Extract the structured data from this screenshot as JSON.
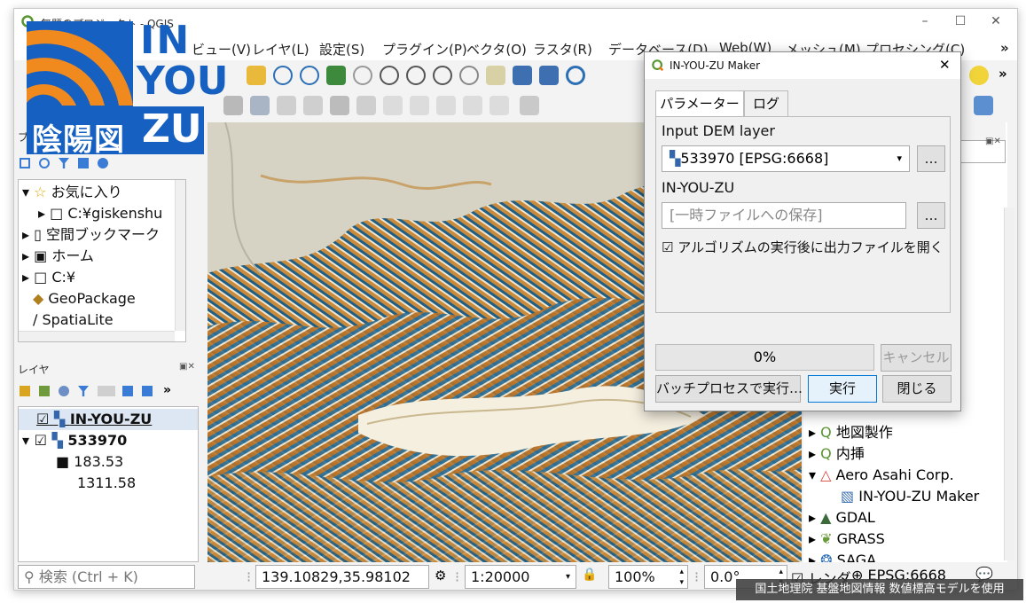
{
  "window": {
    "title": "無題のプロジェクト - QGIS"
  },
  "menubar": {
    "items": [
      "ビュー(V)",
      "レイヤ(L)",
      "設定(S)",
      "プラグイン(P)",
      "ベクタ(O)",
      "ラスタ(R)",
      "データベース(D)",
      "Web(W)",
      "メッシュ(M)",
      "プロセシング(C)"
    ],
    "more": "»"
  },
  "logo": {
    "line1": "IN",
    "line2": "YOU",
    "line3": "ZU",
    "kanji": "陰陽図"
  },
  "browser_panel": {
    "title": "ブ",
    "items": [
      {
        "label": "お気に入り"
      },
      {
        "label": "C:¥giskenshu"
      },
      {
        "label": "空間ブックマーク"
      },
      {
        "label": "ホーム"
      },
      {
        "label": "C:¥"
      },
      {
        "label": "GeoPackage"
      },
      {
        "label": "SpatiaLite"
      }
    ]
  },
  "layers_panel": {
    "title": "レイヤ",
    "more": "»",
    "layers": [
      {
        "name": "IN-YOU-ZU"
      },
      {
        "name": "533970"
      }
    ],
    "legend": {
      "max": "183.53",
      "min": "1311.58"
    }
  },
  "processing_tree": {
    "items": [
      {
        "label": "地図製作"
      },
      {
        "label": "内挿"
      },
      {
        "label": "Aero Asahi Corp."
      },
      {
        "label": "IN-YOU-ZU Maker"
      },
      {
        "label": "GDAL"
      },
      {
        "label": "GRASS"
      },
      {
        "label": "SAGA"
      }
    ]
  },
  "dialog": {
    "title": "IN-YOU-ZU Maker",
    "close": "✕",
    "tabs": [
      "パラメーター",
      "ログ"
    ],
    "dem_label": "Input DEM layer",
    "dem_value": "533970 [EPSG:6668]",
    "browse": "…",
    "output_label": "IN-YOU-ZU",
    "output_placeholder": "[一時ファイルへの保存]",
    "open_after": "アルゴリズムの実行後に出力ファイルを開く",
    "progress": "0%",
    "cancel": "キャンセル",
    "batch": "バッチプロセスで実行…",
    "run": "実行",
    "closebtn": "閉じる"
  },
  "statusbar": {
    "search_placeholder": "検索 (Ctrl + K)",
    "coordinate": "139.10829,35.98102",
    "scale": "1:20000",
    "zoom": "100%",
    "rotation": "0.0°",
    "render": "レンダ",
    "crs": "EPSG:6668"
  },
  "credit": "国土地理院 基盤地図情報 数値標高モデルを使用",
  "colors": {
    "accent": "#1e73be",
    "logo_blue": "#1560c0",
    "logo_orange": "#f08a1e",
    "map_light": "#d8d4c4",
    "map_shade": "#1c5d86",
    "map_relief": "#c97a20"
  }
}
